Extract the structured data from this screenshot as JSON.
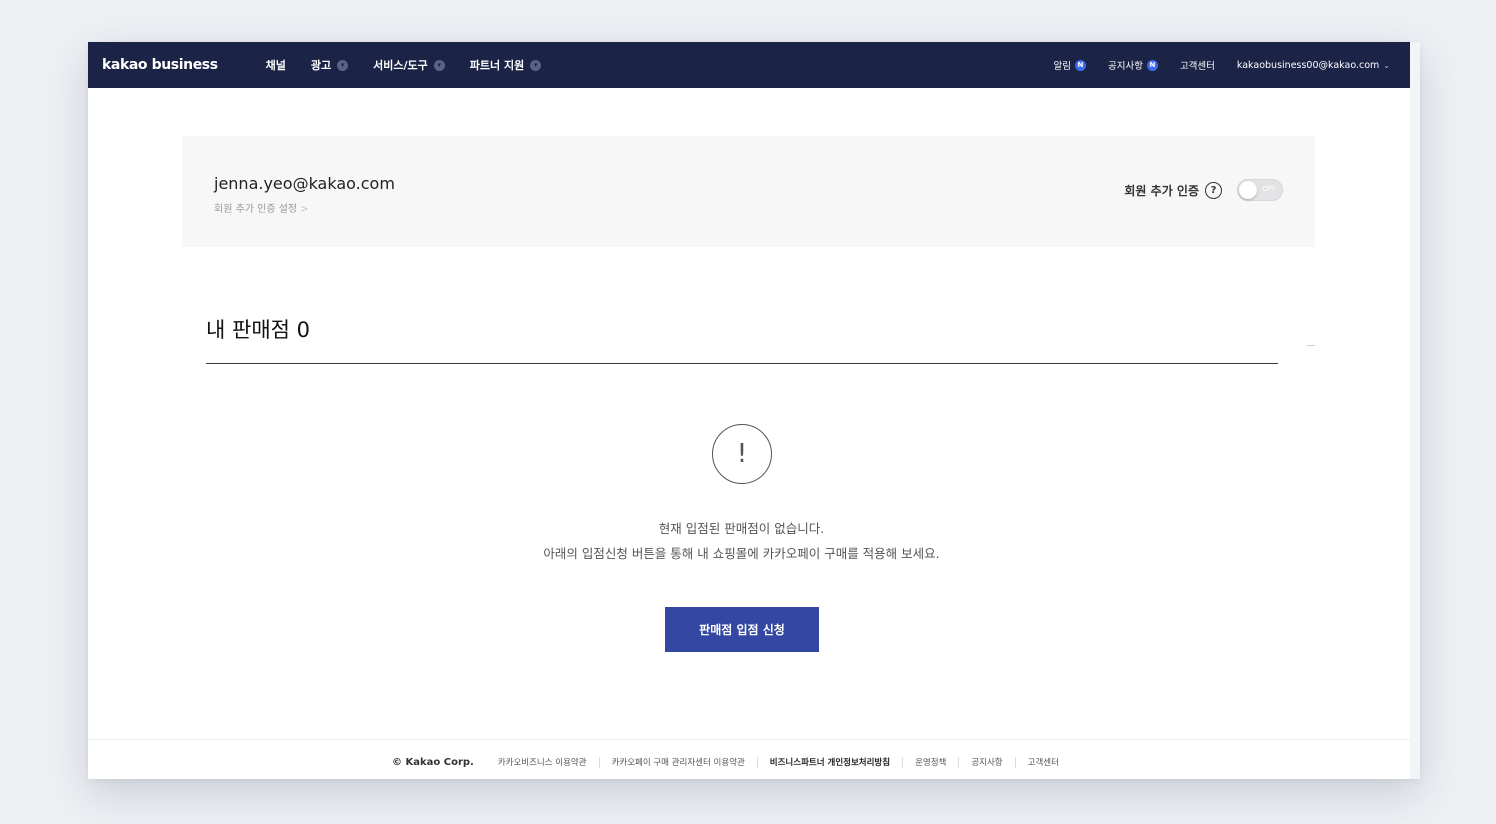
{
  "header": {
    "logo": "kakao business",
    "nav": [
      {
        "label": "채널",
        "dropdown": false
      },
      {
        "label": "광고",
        "dropdown": true
      },
      {
        "label": "서비스/도구",
        "dropdown": true
      },
      {
        "label": "파트너 지원",
        "dropdown": true
      }
    ],
    "utils": {
      "alerts": "알림",
      "alerts_badge": "N",
      "notices": "공지사항",
      "notices_badge": "N",
      "support": "고객센터",
      "account": "kakaobusiness00@kakao.com"
    }
  },
  "account_card": {
    "email": "jenna.yeo@kakao.com",
    "settings_link": "회원 추가 인증 설정",
    "auth_label": "회원 추가 인증",
    "help_glyph": "?",
    "toggle_label": "OFF",
    "toggle_on": false
  },
  "section": {
    "title": "내 판매점 0"
  },
  "empty_state": {
    "icon": "!",
    "line1": "현재 입점된 판매점이 없습니다.",
    "line2": "아래의 입점신청 버튼을 통해 내 쇼핑몰에 카카오페이 구매를 적용해 보세요.",
    "button": "판매점 입점 신청"
  },
  "footer": {
    "copyright": "© Kakao Corp.",
    "links": [
      "카카오비즈니스 이용약관",
      "카카오페이 구매 관리자센터 이용약관",
      "비즈니스파트너 개인정보처리방침",
      "운영정책",
      "공지사항",
      "고객센터"
    ]
  },
  "colors": {
    "header_bg": "#1b2346",
    "badge": "#3d6af0",
    "primary_button": "#3448a3",
    "card_bg": "#f7f7f8",
    "page_bg": "#eef0f4"
  }
}
